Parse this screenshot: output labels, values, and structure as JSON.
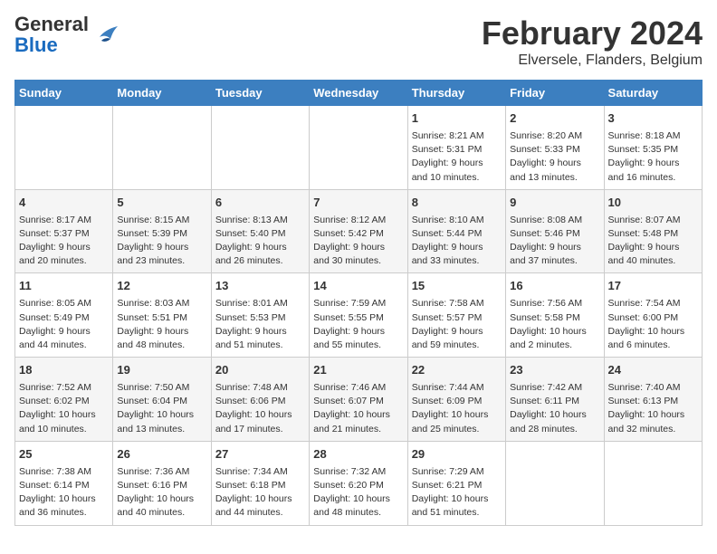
{
  "header": {
    "logo_general": "General",
    "logo_blue": "Blue",
    "title": "February 2024",
    "subtitle": "Elversele, Flanders, Belgium"
  },
  "days_of_week": [
    "Sunday",
    "Monday",
    "Tuesday",
    "Wednesday",
    "Thursday",
    "Friday",
    "Saturday"
  ],
  "weeks": [
    [
      {
        "day": "",
        "content": ""
      },
      {
        "day": "",
        "content": ""
      },
      {
        "day": "",
        "content": ""
      },
      {
        "day": "",
        "content": ""
      },
      {
        "day": "1",
        "content": "Sunrise: 8:21 AM\nSunset: 5:31 PM\nDaylight: 9 hours\nand 10 minutes."
      },
      {
        "day": "2",
        "content": "Sunrise: 8:20 AM\nSunset: 5:33 PM\nDaylight: 9 hours\nand 13 minutes."
      },
      {
        "day": "3",
        "content": "Sunrise: 8:18 AM\nSunset: 5:35 PM\nDaylight: 9 hours\nand 16 minutes."
      }
    ],
    [
      {
        "day": "4",
        "content": "Sunrise: 8:17 AM\nSunset: 5:37 PM\nDaylight: 9 hours\nand 20 minutes."
      },
      {
        "day": "5",
        "content": "Sunrise: 8:15 AM\nSunset: 5:39 PM\nDaylight: 9 hours\nand 23 minutes."
      },
      {
        "day": "6",
        "content": "Sunrise: 8:13 AM\nSunset: 5:40 PM\nDaylight: 9 hours\nand 26 minutes."
      },
      {
        "day": "7",
        "content": "Sunrise: 8:12 AM\nSunset: 5:42 PM\nDaylight: 9 hours\nand 30 minutes."
      },
      {
        "day": "8",
        "content": "Sunrise: 8:10 AM\nSunset: 5:44 PM\nDaylight: 9 hours\nand 33 minutes."
      },
      {
        "day": "9",
        "content": "Sunrise: 8:08 AM\nSunset: 5:46 PM\nDaylight: 9 hours\nand 37 minutes."
      },
      {
        "day": "10",
        "content": "Sunrise: 8:07 AM\nSunset: 5:48 PM\nDaylight: 9 hours\nand 40 minutes."
      }
    ],
    [
      {
        "day": "11",
        "content": "Sunrise: 8:05 AM\nSunset: 5:49 PM\nDaylight: 9 hours\nand 44 minutes."
      },
      {
        "day": "12",
        "content": "Sunrise: 8:03 AM\nSunset: 5:51 PM\nDaylight: 9 hours\nand 48 minutes."
      },
      {
        "day": "13",
        "content": "Sunrise: 8:01 AM\nSunset: 5:53 PM\nDaylight: 9 hours\nand 51 minutes."
      },
      {
        "day": "14",
        "content": "Sunrise: 7:59 AM\nSunset: 5:55 PM\nDaylight: 9 hours\nand 55 minutes."
      },
      {
        "day": "15",
        "content": "Sunrise: 7:58 AM\nSunset: 5:57 PM\nDaylight: 9 hours\nand 59 minutes."
      },
      {
        "day": "16",
        "content": "Sunrise: 7:56 AM\nSunset: 5:58 PM\nDaylight: 10 hours\nand 2 minutes."
      },
      {
        "day": "17",
        "content": "Sunrise: 7:54 AM\nSunset: 6:00 PM\nDaylight: 10 hours\nand 6 minutes."
      }
    ],
    [
      {
        "day": "18",
        "content": "Sunrise: 7:52 AM\nSunset: 6:02 PM\nDaylight: 10 hours\nand 10 minutes."
      },
      {
        "day": "19",
        "content": "Sunrise: 7:50 AM\nSunset: 6:04 PM\nDaylight: 10 hours\nand 13 minutes."
      },
      {
        "day": "20",
        "content": "Sunrise: 7:48 AM\nSunset: 6:06 PM\nDaylight: 10 hours\nand 17 minutes."
      },
      {
        "day": "21",
        "content": "Sunrise: 7:46 AM\nSunset: 6:07 PM\nDaylight: 10 hours\nand 21 minutes."
      },
      {
        "day": "22",
        "content": "Sunrise: 7:44 AM\nSunset: 6:09 PM\nDaylight: 10 hours\nand 25 minutes."
      },
      {
        "day": "23",
        "content": "Sunrise: 7:42 AM\nSunset: 6:11 PM\nDaylight: 10 hours\nand 28 minutes."
      },
      {
        "day": "24",
        "content": "Sunrise: 7:40 AM\nSunset: 6:13 PM\nDaylight: 10 hours\nand 32 minutes."
      }
    ],
    [
      {
        "day": "25",
        "content": "Sunrise: 7:38 AM\nSunset: 6:14 PM\nDaylight: 10 hours\nand 36 minutes."
      },
      {
        "day": "26",
        "content": "Sunrise: 7:36 AM\nSunset: 6:16 PM\nDaylight: 10 hours\nand 40 minutes."
      },
      {
        "day": "27",
        "content": "Sunrise: 7:34 AM\nSunset: 6:18 PM\nDaylight: 10 hours\nand 44 minutes."
      },
      {
        "day": "28",
        "content": "Sunrise: 7:32 AM\nSunset: 6:20 PM\nDaylight: 10 hours\nand 48 minutes."
      },
      {
        "day": "29",
        "content": "Sunrise: 7:29 AM\nSunset: 6:21 PM\nDaylight: 10 hours\nand 51 minutes."
      },
      {
        "day": "",
        "content": ""
      },
      {
        "day": "",
        "content": ""
      }
    ]
  ]
}
